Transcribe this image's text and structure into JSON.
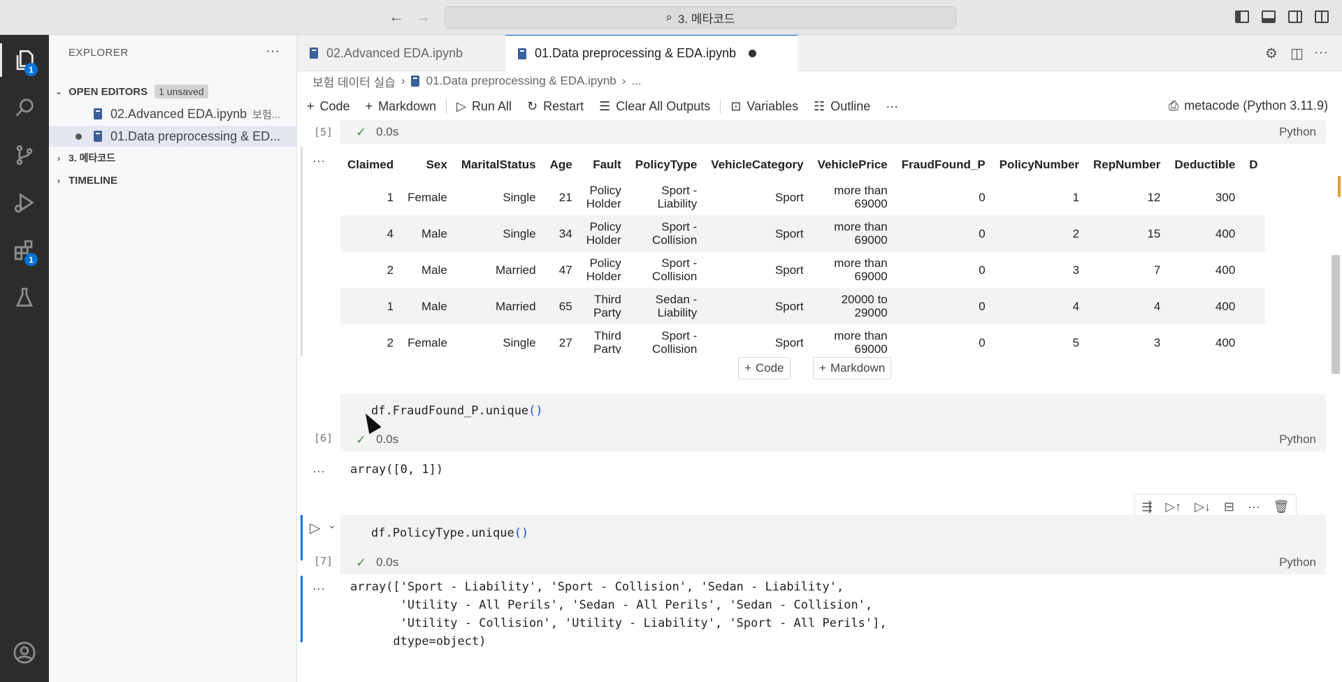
{
  "titlebar": {
    "search_label": "3. 메타코드"
  },
  "activity": {
    "explorer_badge": "1",
    "extensions_badge": "1"
  },
  "sidebar": {
    "title": "EXPLORER",
    "open_editors": {
      "label": "OPEN EDITORS",
      "badge": "1 unsaved"
    },
    "files": [
      {
        "name": "02.Advanced EDA.ipynb",
        "path": "보험..."
      },
      {
        "name": "01.Data preprocessing & ED..."
      }
    ],
    "folder_label": "3. 메타코드",
    "timeline_label": "TIMELINE"
  },
  "tabs": [
    {
      "label": "02.Advanced EDA.ipynb"
    },
    {
      "label": "01.Data preprocessing & EDA.ipynb"
    }
  ],
  "breadcrumb": {
    "root": "보험 데이터 실습",
    "file": "01.Data preprocessing & EDA.ipynb",
    "ellipsis": "..."
  },
  "toolbar": {
    "code": "Code",
    "markdown": "Markdown",
    "run_all": "Run All",
    "restart": "Restart",
    "clear": "Clear All Outputs",
    "variables": "Variables",
    "outline": "Outline",
    "more": "···",
    "kernel": "metacode (Python 3.11.9)"
  },
  "cells": {
    "c5": {
      "count": "[5]",
      "time": "0.0s",
      "lang": "Python"
    },
    "c6": {
      "count": "[6]",
      "time": "0.0s",
      "lang": "Python",
      "code_obj": "df.FraudFound_P.unique",
      "output": "array([0, 1])"
    },
    "c7": {
      "count": "[7]",
      "time": "0.0s",
      "lang": "Python",
      "code_obj": "df.PolicyType.unique",
      "output": "array(['Sport - Liability', 'Sport - Collision', 'Sedan - Liability',\n       'Utility - All Perils', 'Sedan - All Perils', 'Sedan - Collision',\n       'Utility - Collision', 'Utility - Liability', 'Sport - All Perils'],\n      dtype=object)"
    }
  },
  "add_cell": {
    "code": "Code",
    "markdown": "Markdown"
  },
  "df": {
    "columns": [
      "Claimed",
      "Sex",
      "MaritalStatus",
      "Age",
      "Fault",
      "PolicyType",
      "VehicleCategory",
      "VehiclePrice",
      "FraudFound_P",
      "PolicyNumber",
      "RepNumber",
      "Deductible",
      "D"
    ],
    "rows": [
      [
        "1",
        "Female",
        "Single",
        "21",
        "Policy\nHolder",
        "Sport -\nLiability",
        "Sport",
        "more than\n69000",
        "0",
        "1",
        "12",
        "300",
        ""
      ],
      [
        "4",
        "Male",
        "Single",
        "34",
        "Policy\nHolder",
        "Sport -\nCollision",
        "Sport",
        "more than\n69000",
        "0",
        "2",
        "15",
        "400",
        ""
      ],
      [
        "2",
        "Male",
        "Married",
        "47",
        "Policy\nHolder",
        "Sport -\nCollision",
        "Sport",
        "more than\n69000",
        "0",
        "3",
        "7",
        "400",
        ""
      ],
      [
        "1",
        "Male",
        "Married",
        "65",
        "Third\nParty",
        "Sedan -\nLiability",
        "Sport",
        "20000 to\n29000",
        "0",
        "4",
        "4",
        "400",
        ""
      ],
      [
        "2",
        "Female",
        "Single",
        "27",
        "Third\nParty",
        "Sport -\nCollision",
        "Sport",
        "more than\n69000",
        "0",
        "5",
        "3",
        "400",
        ""
      ]
    ]
  }
}
